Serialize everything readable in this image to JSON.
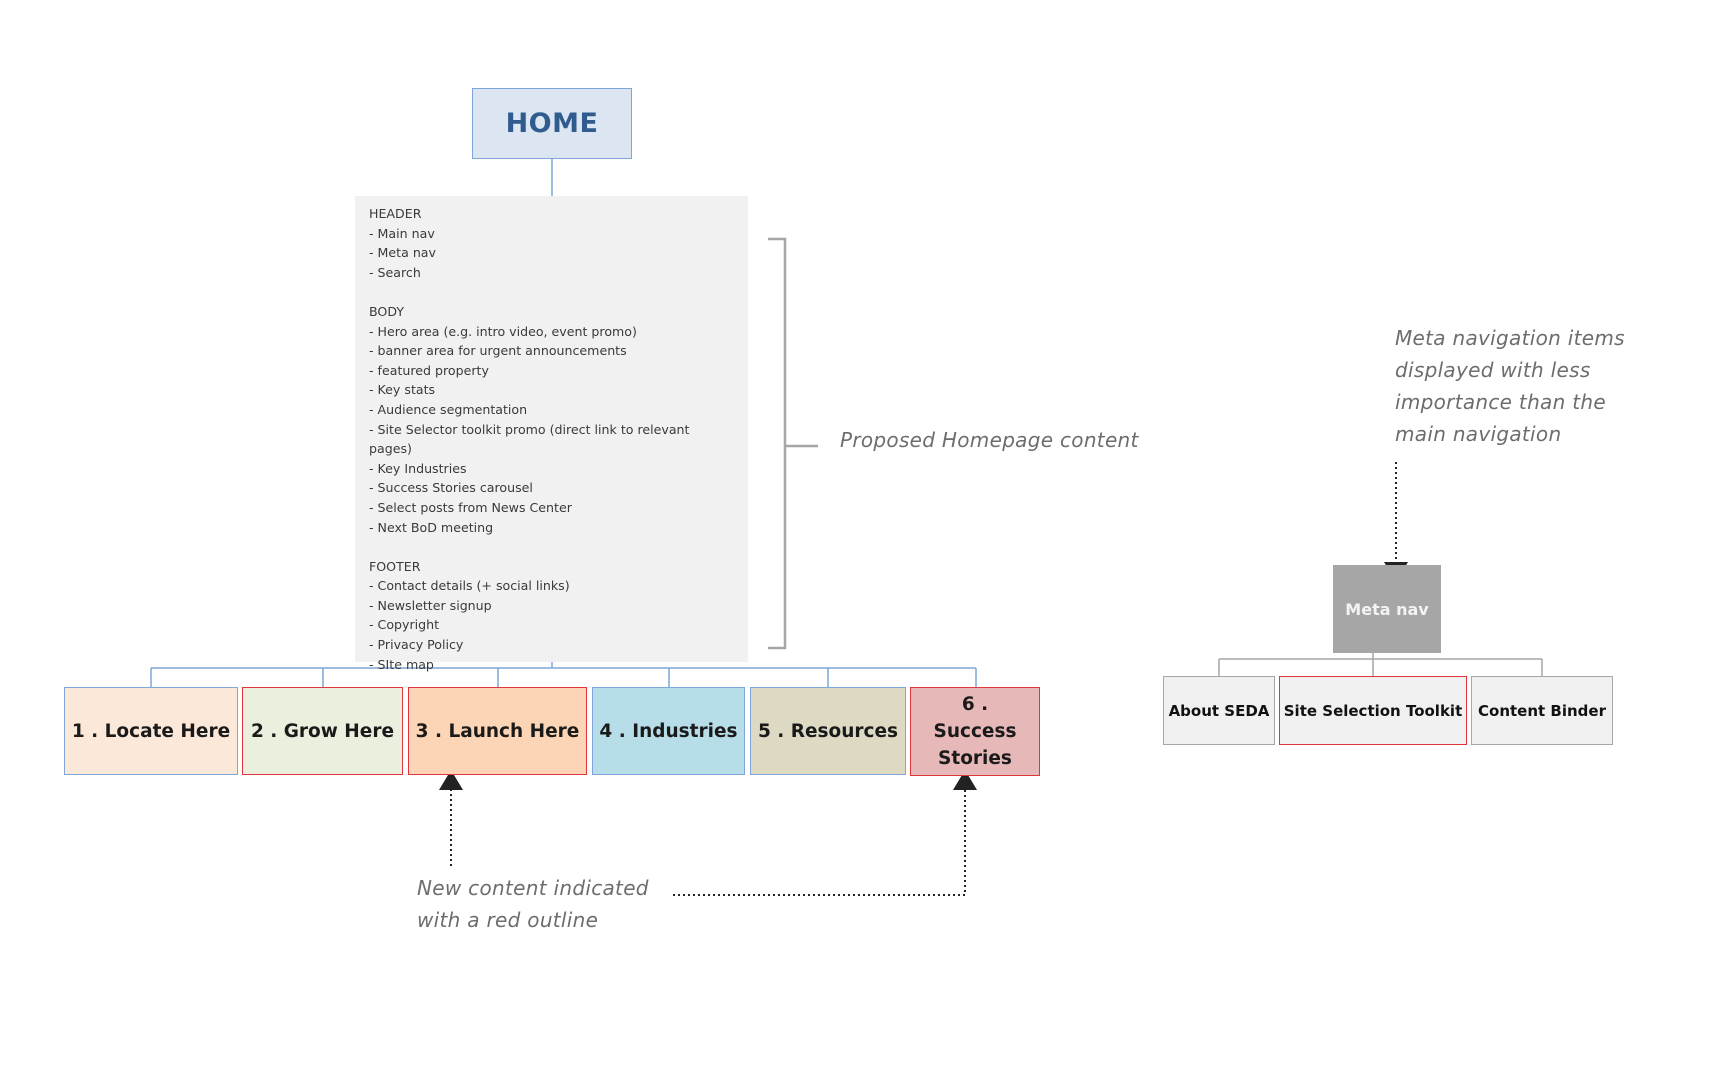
{
  "home": {
    "label": "HOME"
  },
  "homepage_content": {
    "sections": [
      {
        "heading": "HEADER",
        "items": [
          "- Main nav",
          "- Meta nav",
          "- Search"
        ]
      },
      {
        "heading": "BODY",
        "items": [
          "- Hero area (e.g. intro video, event promo)",
          "- banner area for urgent announcements",
          "- featured property",
          "- Key stats",
          "- Audience segmentation",
          "- Site Selector toolkit promo (direct link to relevant pages)",
          "- Key Industries",
          "- Success Stories carousel",
          "- Select posts from News Center",
          "- Next BoD meeting"
        ]
      },
      {
        "heading": "FOOTER",
        "items": [
          "- Contact details (+ social links)",
          "- Newsletter signup",
          "- Copyright",
          "- Privacy Policy",
          "- SIte map"
        ]
      }
    ],
    "annotation": "Proposed Homepage content"
  },
  "main_nav": {
    "items": [
      {
        "label": "1 . Locate Here",
        "fill": "#fce8d9",
        "border": "#7ea6d8",
        "is_new": false
      },
      {
        "label": "2 . Grow Here",
        "fill": "#eaf0dd",
        "border": "#e0363b",
        "is_new": true
      },
      {
        "label": "3 . Launch Here",
        "fill": "#fbd5b5",
        "border": "#e0363b",
        "is_new": true
      },
      {
        "label": "4 . Industries",
        "fill": "#b7dde8",
        "border": "#7ea6d8",
        "is_new": false
      },
      {
        "label": "5 . Resources",
        "fill": "#ddd9c3",
        "border": "#7ea6d8",
        "is_new": false
      },
      {
        "label": "6 . Success Stories",
        "fill": "#e6b8b7",
        "border": "#e0363b",
        "is_new": true
      }
    ],
    "annotation_line1": "New content indicated",
    "annotation_line2": "with a red outline"
  },
  "meta_nav": {
    "label": "Meta nav",
    "items": [
      {
        "label": "About SEDA",
        "is_new": false
      },
      {
        "label": "Site Selection Toolkit",
        "is_new": true
      },
      {
        "label": "Content Binder",
        "is_new": false
      }
    ],
    "annotation_lines": [
      "Meta navigation items",
      "displayed with less",
      "importance than the",
      "main navigation"
    ]
  },
  "colors": {
    "home_fill": "#dce6f2",
    "home_text": "#2f5b8e",
    "connector_blue": "#7ea6d8",
    "new_outline_red": "#e0363b",
    "meta_gray": "#a6a6a6",
    "annotation_gray": "#6d6d6d"
  }
}
